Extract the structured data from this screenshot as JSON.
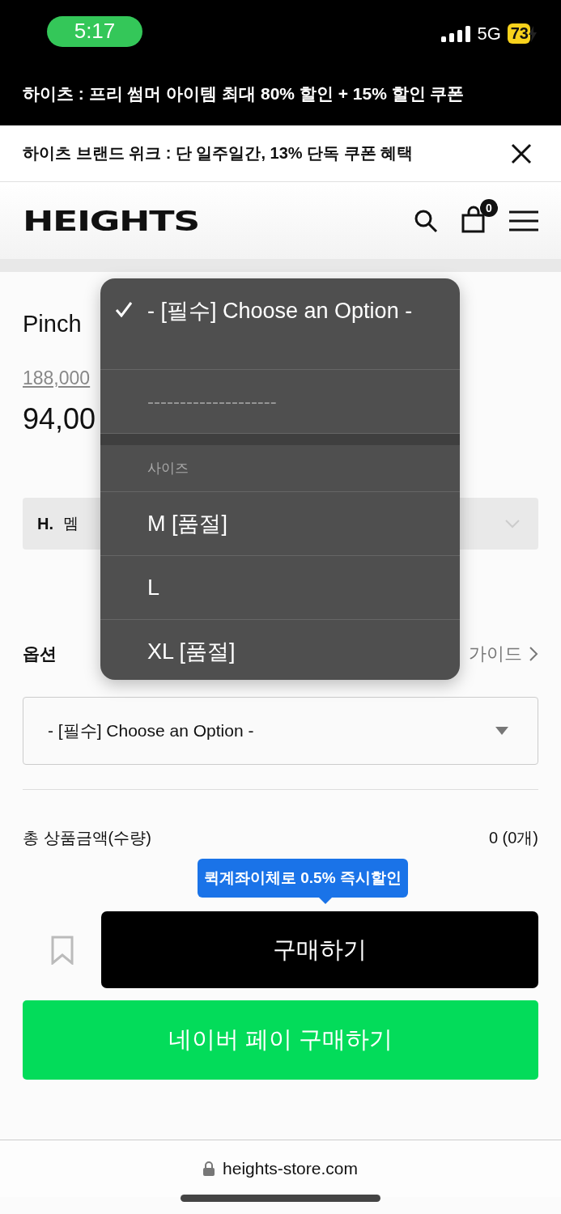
{
  "status_bar": {
    "time": "5:17",
    "network": "5G",
    "battery": "73",
    "charging": true
  },
  "promo_bar": {
    "text": "하이츠 : 프리 썸머 아이템 최대 80% 할인 + 15% 할인 쿠폰"
  },
  "brand_week_banner": {
    "text": "하이츠 브랜드 위크 : 단 일주일간, 13% 단독 쿠폰 혜택"
  },
  "header": {
    "logo": "HEIGHTS",
    "cart_count": "0"
  },
  "product": {
    "name": "Pinch",
    "original_price": "188,000",
    "price": "94,00"
  },
  "membership": {
    "logo": "H.",
    "label": "멤"
  },
  "option": {
    "label": "옵션",
    "guide_link": "가이드",
    "select_value": "- [필수] Choose an Option -"
  },
  "total": {
    "label": "총 상품금액(수량)",
    "value": "0 (0개)"
  },
  "tooltip": "퀵계좌이체로 0.5% 즉시할인",
  "buy_button": "구매하기",
  "naver_button": "네이버 페이 구매하기",
  "url_bar": {
    "url": "heights-store.com"
  },
  "dropdown": {
    "options": [
      {
        "kind": "option",
        "label": "- [필수] Choose an Option -",
        "selected": true
      },
      {
        "kind": "option",
        "label": "--------------------",
        "selected": false
      },
      {
        "kind": "group",
        "label": "사이즈"
      },
      {
        "kind": "option",
        "label": "M [품절]",
        "selected": false
      },
      {
        "kind": "option",
        "label": "L",
        "selected": false
      },
      {
        "kind": "option",
        "label": "XL [품절]",
        "selected": false
      }
    ]
  }
}
